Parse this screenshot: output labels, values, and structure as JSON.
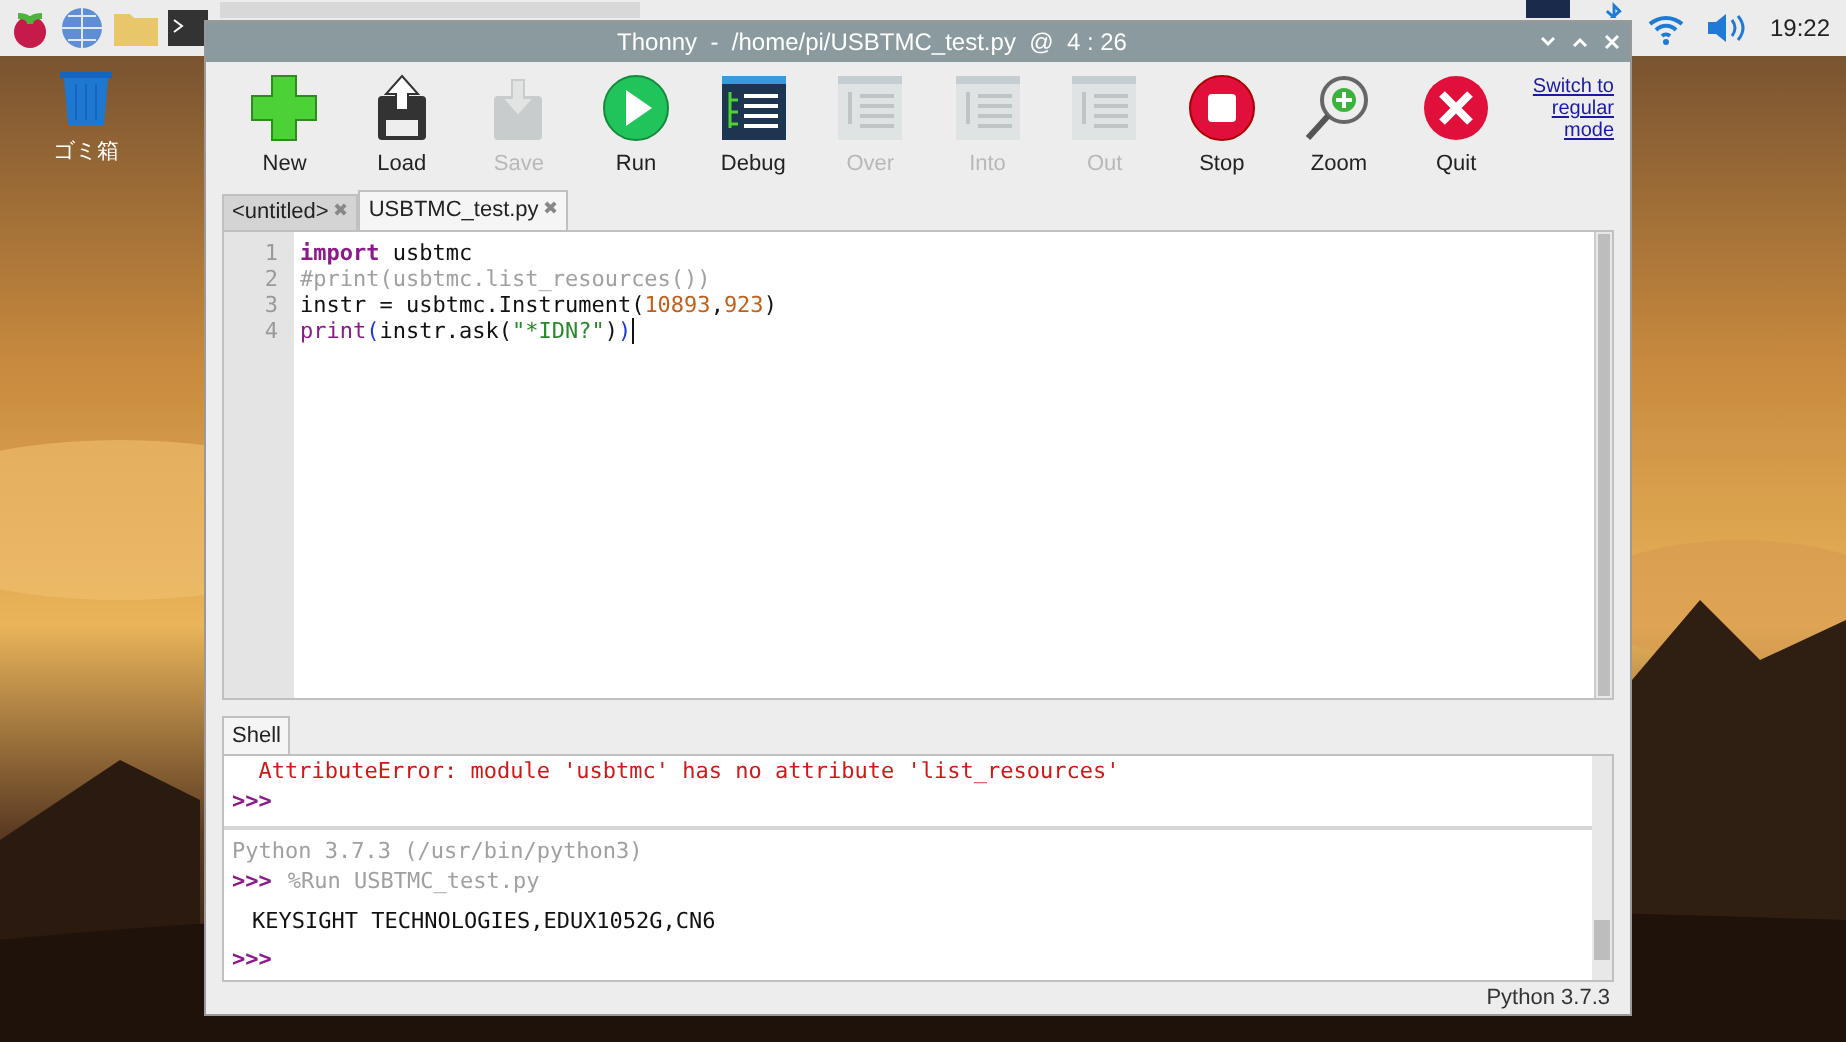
{
  "taskbar": {
    "clock": "19:22"
  },
  "desktop": {
    "icons": [
      {
        "label": "ゴミ箱"
      }
    ]
  },
  "window": {
    "title": "Thonny  -  /home/pi/USBTMC_test.py  @  4 : 26"
  },
  "toolbar": {
    "buttons": [
      {
        "label": "New",
        "disabled": false
      },
      {
        "label": "Load",
        "disabled": false
      },
      {
        "label": "Save",
        "disabled": true
      },
      {
        "label": "Run",
        "disabled": false
      },
      {
        "label": "Debug",
        "disabled": false
      },
      {
        "label": "Over",
        "disabled": true
      },
      {
        "label": "Into",
        "disabled": true
      },
      {
        "label": "Out",
        "disabled": true
      },
      {
        "label": "Stop",
        "disabled": false
      },
      {
        "label": "Zoom",
        "disabled": false
      },
      {
        "label": "Quit",
        "disabled": false
      }
    ],
    "mode_link": "Switch to regular mode"
  },
  "editor_tabs": [
    {
      "label": "<untitled>",
      "close": "✖",
      "selected": false
    },
    {
      "label": "USBTMC_test.py",
      "close": "✖",
      "selected": true
    }
  ],
  "editor": {
    "lines": [
      {
        "number": "1",
        "tokens": [
          {
            "kind": "keyword",
            "text": "import"
          },
          {
            "kind": "plain",
            "text": " usbtmc"
          }
        ]
      },
      {
        "number": "2",
        "tokens": [
          {
            "kind": "comment",
            "text": "#print(usbtmc.list_resources())"
          }
        ]
      },
      {
        "number": "3",
        "tokens": [
          {
            "kind": "plain",
            "text": "instr = usbtmc.Instrument("
          },
          {
            "kind": "number",
            "text": "10893"
          },
          {
            "kind": "plain",
            "text": ","
          },
          {
            "kind": "number",
            "text": "923"
          },
          {
            "kind": "plain",
            "text": ")"
          }
        ]
      },
      {
        "number": "4",
        "tokens": [
          {
            "kind": "builtin",
            "text": "print"
          },
          {
            "kind": "match",
            "text": "("
          },
          {
            "kind": "plain",
            "text": "instr.ask("
          },
          {
            "kind": "string",
            "text": "\"*IDN?\""
          },
          {
            "kind": "plain",
            "text": ")"
          },
          {
            "kind": "match",
            "text": ")"
          }
        ]
      }
    ]
  },
  "shell": {
    "tab": "Shell",
    "lines": [
      {
        "kind": "error",
        "text": "AttributeError: module 'usbtmc' has no attribute 'list_resources'"
      },
      {
        "kind": "prompt",
        "prompt": ">>>"
      },
      {
        "kind": "divider"
      },
      {
        "kind": "info",
        "text": "Python 3.7.3 (/usr/bin/python3)"
      },
      {
        "kind": "prompt",
        "prompt": ">>>",
        "text": "%Run USBTMC_test.py"
      },
      {
        "kind": "output",
        "text": "KEYSIGHT TECHNOLOGIES,EDUX1052G,CN6"
      },
      {
        "kind": "prompt",
        "prompt": ">>>"
      }
    ]
  },
  "status_bar": {
    "interpreter": "Python 3.7.3"
  }
}
